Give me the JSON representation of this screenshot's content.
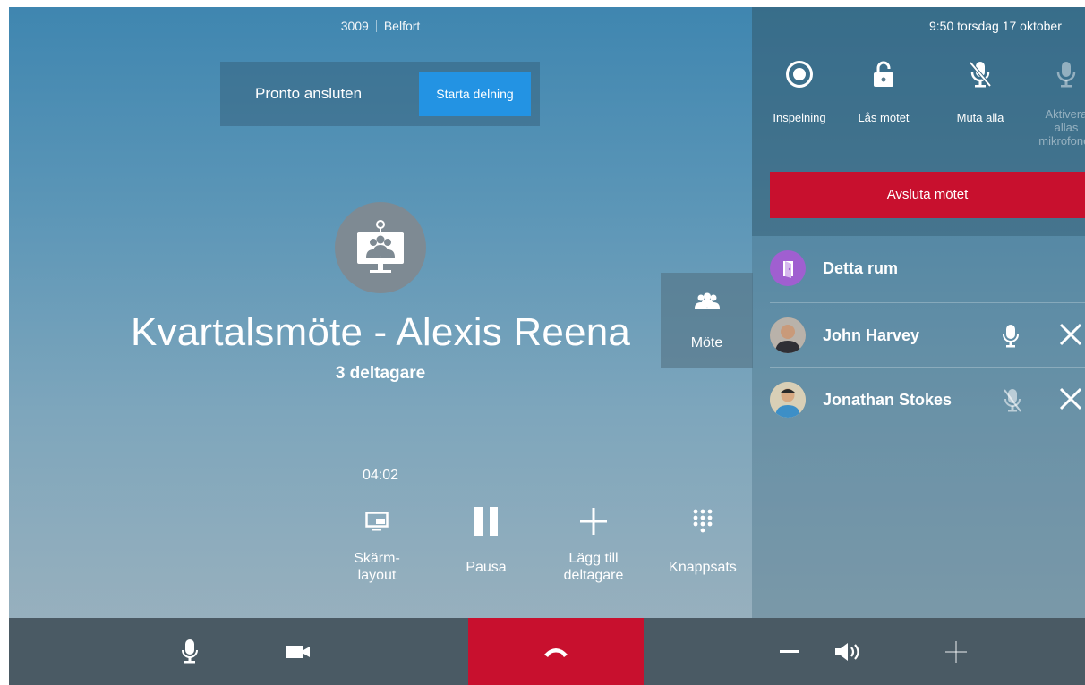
{
  "header": {
    "room_number": "3009",
    "room_name": "Belfort"
  },
  "pronto": {
    "label": "Pronto ansluten",
    "share_button": "Starta delning"
  },
  "meeting": {
    "title": "Kvartalsmöte - Alexis Reena",
    "participants": "3 deltagare",
    "timer": "04:02"
  },
  "tab": {
    "label": "Möte"
  },
  "controls": {
    "layout_line1": "Skärm-",
    "layout_line2": "layout",
    "pause": "Pausa",
    "add_line1": "Lägg till",
    "add_line2": "deltagare",
    "keypad": "Knappsats"
  },
  "panel": {
    "clock": "9:50   torsdag 17 oktober",
    "record": "Inspelning",
    "lock": "Lås mötet",
    "mute_all": "Muta alla",
    "unmute_line1": "Aktivera",
    "unmute_line2": "allas",
    "unmute_line3": "mikrofoner",
    "end_meeting": "Avsluta mötet"
  },
  "participants": [
    {
      "name": "Detta rum"
    },
    {
      "name": "John Harvey",
      "mic": "on"
    },
    {
      "name": "Jonathan Stokes",
      "mic": "muted"
    }
  ],
  "colors": {
    "accent_blue": "#2393e3",
    "danger_red": "#c8102e",
    "room_purple": "#a05fd0",
    "bottom_bar": "#4a5a64"
  },
  "icons": [
    "meeting-room-icon",
    "group-icon",
    "screen-layout-icon",
    "pause-icon",
    "plus-icon",
    "keypad-icon",
    "record-icon",
    "lock-icon",
    "mic-muted-icon",
    "mic-icon",
    "door-icon",
    "close-icon",
    "camera-icon",
    "hangup-icon",
    "minus-icon",
    "volume-icon"
  ]
}
